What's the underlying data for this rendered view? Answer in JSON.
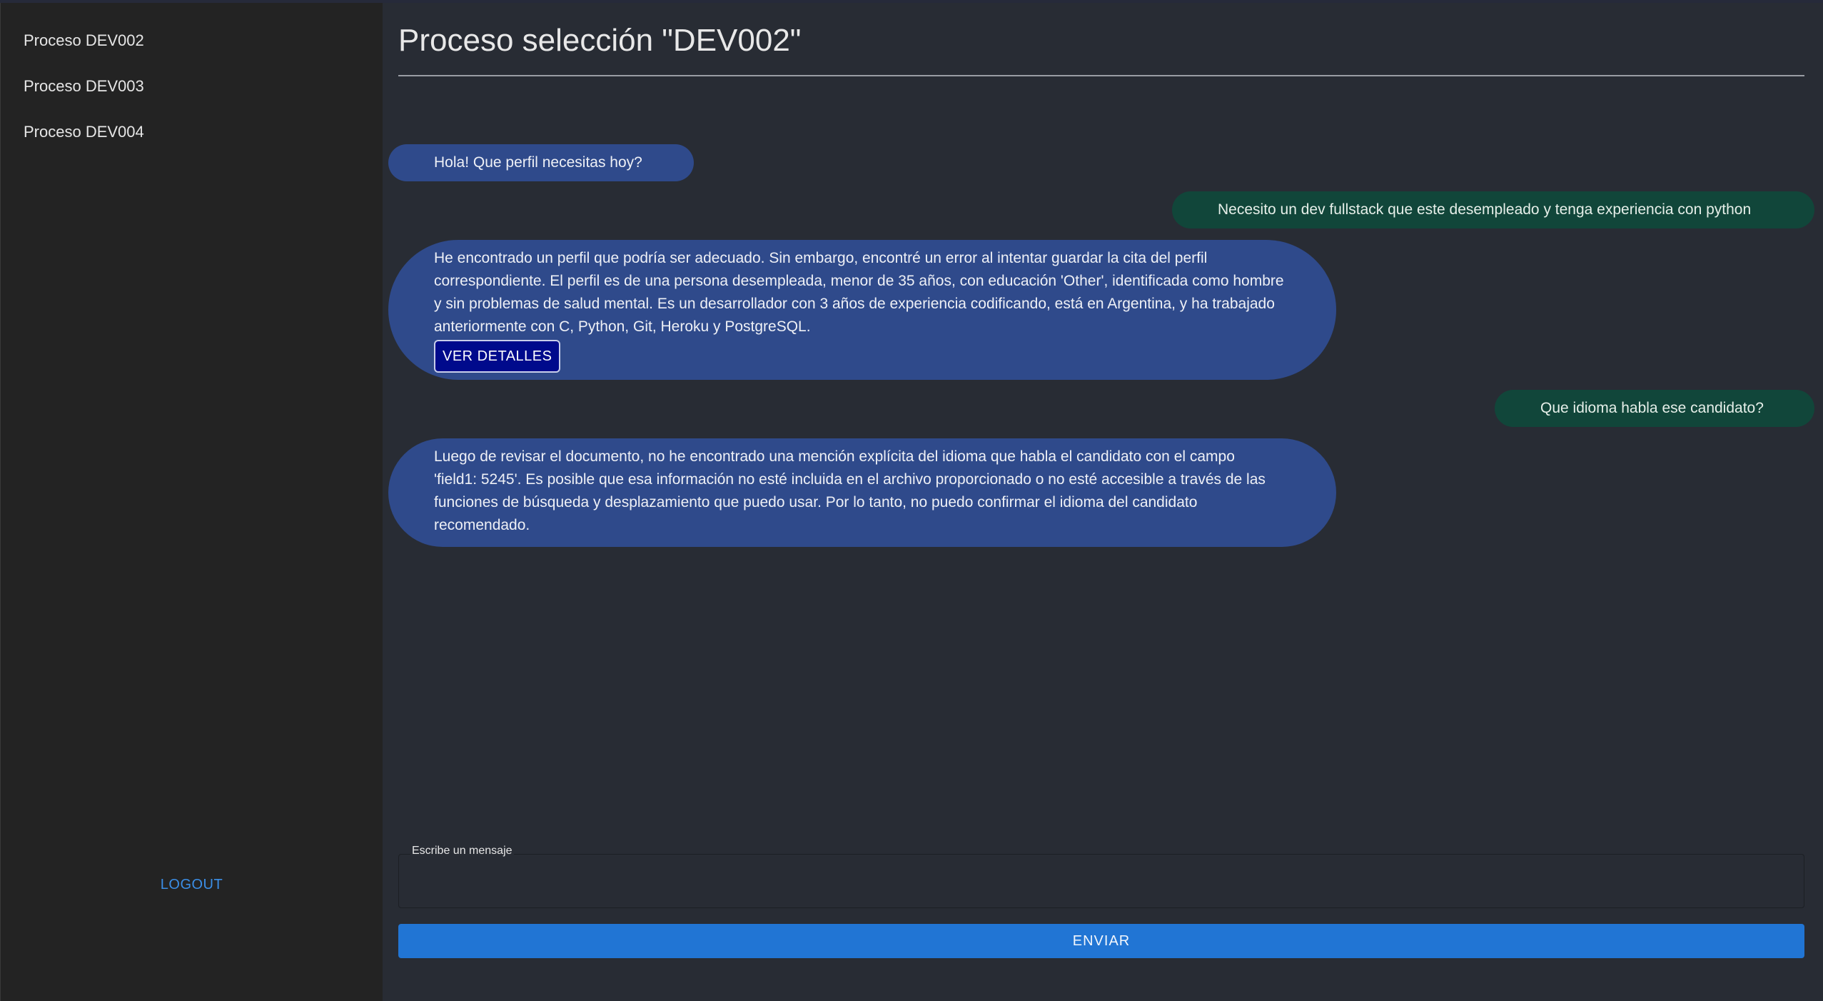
{
  "sidebar": {
    "items": [
      {
        "label": "Proceso DEV002"
      },
      {
        "label": "Proceso DEV003"
      },
      {
        "label": "Proceso DEV004"
      }
    ],
    "logout_label": "LOGOUT"
  },
  "main": {
    "title": "Proceso selección \"DEV002\"",
    "messages": [
      {
        "role": "bot",
        "text": "Hola! Que perfil necesitas hoy?"
      },
      {
        "role": "user",
        "text": "Necesito un dev fullstack que este desempleado y tenga experiencia con python"
      },
      {
        "role": "bot",
        "text": "He encontrado un perfil que podría ser adecuado. Sin embargo, encontré un error al intentar guardar la cita del perfil correspondiente. El perfil es de una persona desempleada, menor de 35 años, con educación 'Other', identificada como hombre y sin problemas de salud mental. Es un desarrollador con 3 años de experiencia codificando, está en Argentina, y ha trabajado anteriormente con C, Python, Git, Heroku y PostgreSQL.",
        "button_label": "VER DETALLES"
      },
      {
        "role": "user",
        "text": "Que idioma habla ese candidato?"
      },
      {
        "role": "bot",
        "text": "Luego de revisar el documento, no he encontrado una mención explícita del idioma que habla el candidato con el campo 'field1: 5245'. Es posible que esa información no esté incluida en el archivo proporcionado o no esté accesible a través de las funciones de búsqueda y desplazamiento que puedo usar. Por lo tanto, no puedo confirmar el idioma del candidato recomendado."
      }
    ],
    "input": {
      "label": "Escribe un mensaje",
      "value": ""
    },
    "send_label": "ENVIAR"
  },
  "colors": {
    "sidebar_bg": "#232323",
    "main_bg": "#282c34",
    "bot_bubble": "#2f4a8b",
    "user_bubble": "#11463a",
    "details_button": "#000a8c",
    "send_button": "#2175d4",
    "logout_link": "#3b8ee6"
  }
}
